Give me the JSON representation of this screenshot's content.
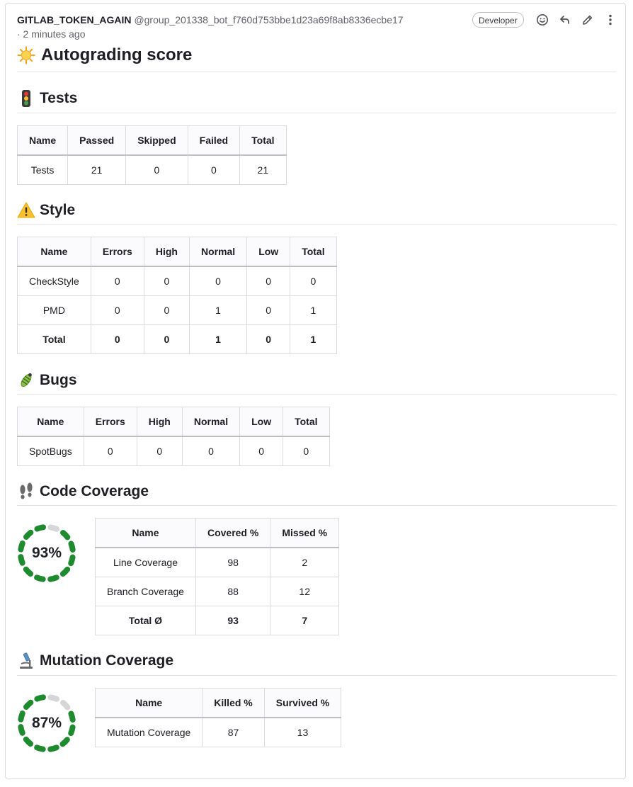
{
  "header": {
    "author_name": "GITLAB_TOKEN_AGAIN",
    "author_handle": "@group_201338_bot_f760d753bbe1d23a69f8ab8336ecbe17",
    "time": "· 2 minutes ago",
    "role_badge": "Developer",
    "icons": [
      "smiley-icon",
      "reply-icon",
      "pencil-icon",
      "more-vertical-icon"
    ]
  },
  "title": "Autograding score",
  "colors": {
    "ring_active": "#1e8b2f",
    "ring_inactive": "#d6d6d6"
  },
  "tests": {
    "heading": "Tests",
    "columns": [
      "Name",
      "Passed",
      "Skipped",
      "Failed",
      "Total"
    ],
    "rows": [
      [
        "Tests",
        "21",
        "0",
        "0",
        "21"
      ]
    ]
  },
  "style": {
    "heading": "Style",
    "columns": [
      "Name",
      "Errors",
      "High",
      "Normal",
      "Low",
      "Total"
    ],
    "rows": [
      [
        "CheckStyle",
        "0",
        "0",
        "0",
        "0",
        "0"
      ],
      [
        "PMD",
        "0",
        "0",
        "1",
        "0",
        "1"
      ],
      [
        "Total",
        "0",
        "0",
        "1",
        "0",
        "1"
      ]
    ]
  },
  "bugs": {
    "heading": "Bugs",
    "columns": [
      "Name",
      "Errors",
      "High",
      "Normal",
      "Low",
      "Total"
    ],
    "rows": [
      [
        "SpotBugs",
        "0",
        "0",
        "0",
        "0",
        "0"
      ]
    ]
  },
  "code_coverage": {
    "heading": "Code Coverage",
    "score_label": "93%",
    "score_fraction": 0.93,
    "columns": [
      "Name",
      "Covered %",
      "Missed %"
    ],
    "rows": [
      [
        "Line Coverage",
        "98",
        "2"
      ],
      [
        "Branch Coverage",
        "88",
        "12"
      ],
      [
        "Total Ø",
        "93",
        "7"
      ]
    ]
  },
  "mutation_coverage": {
    "heading": "Mutation Coverage",
    "score_label": "87%",
    "score_fraction": 0.87,
    "columns": [
      "Name",
      "Killed %",
      "Survived %"
    ],
    "rows": [
      [
        "Mutation Coverage",
        "87",
        "13"
      ]
    ]
  }
}
